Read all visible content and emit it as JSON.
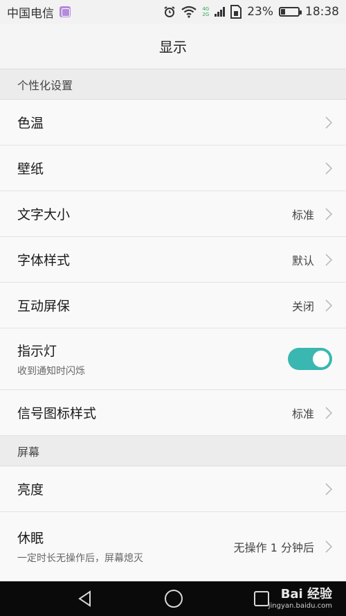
{
  "status_bar": {
    "carrier": "中国电信",
    "net_4g": "4G",
    "net_2g": "2G",
    "battery_percent": "23%",
    "battery_level": 0.23,
    "time": "18:38"
  },
  "header": {
    "title": "显示"
  },
  "sections": {
    "personalization": {
      "title": "个性化设置"
    },
    "screen": {
      "title": "屏幕"
    }
  },
  "items": {
    "color_temp": {
      "label": "色温"
    },
    "wallpaper": {
      "label": "壁纸"
    },
    "font_size": {
      "label": "文字大小",
      "value": "标准"
    },
    "font_style": {
      "label": "字体样式",
      "value": "默认"
    },
    "screensaver": {
      "label": "互动屏保",
      "value": "关闭"
    },
    "indicator": {
      "label": "指示灯",
      "sub": "收到通知时闪烁",
      "enabled": true
    },
    "signal_icon_style": {
      "label": "信号图标样式",
      "value": "标准"
    },
    "brightness": {
      "label": "亮度"
    },
    "sleep": {
      "label": "休眠",
      "sub": "一定时长无操作后，屏幕熄灭",
      "value": "无操作 1 分钟后"
    }
  },
  "watermark": {
    "brand": "Bai 经验",
    "url": "jingyan.baidu.com"
  },
  "colors": {
    "accent": "#39b7b0",
    "nav_bg": "#0a0a0a"
  }
}
